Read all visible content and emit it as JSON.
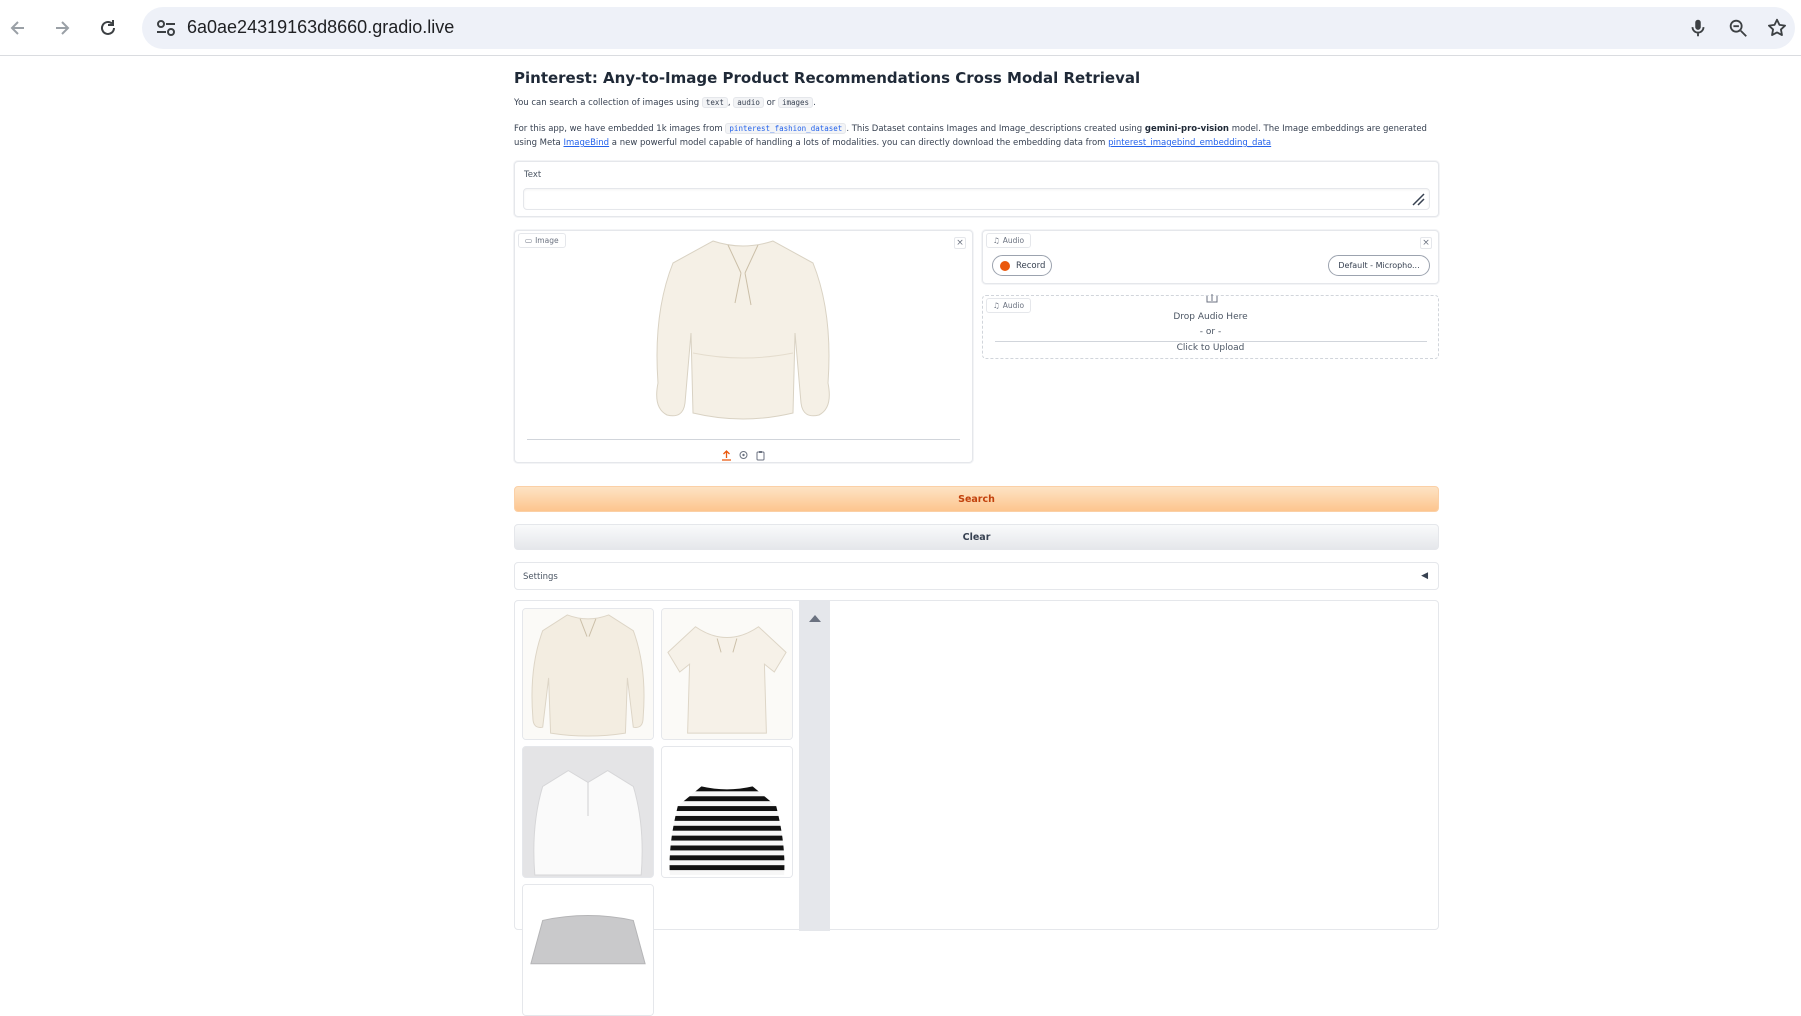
{
  "browser": {
    "url": "6a0ae24319163d8660.gradio.live"
  },
  "app": {
    "title": "Pinterest: Any-to-Image Product Recommendations Cross Modal Retrieval",
    "intro_prefix": "You can search a collection of images using",
    "intro_code_text": "text",
    "intro_sep": ",",
    "intro_code_audio": "audio",
    "intro_or": "or",
    "intro_code_images": "images",
    "intro_suffix": ".",
    "desc_part1": "For this app, we have embedded 1k images from",
    "desc_dataset": "pinterest_fashion_dataset",
    "desc_part2": ". This Dataset contains Images and Image_descriptions created using",
    "desc_model": "gemini-pro-vision",
    "desc_part3": "model. The Image embeddings are generated using Meta",
    "desc_link_imagebind": "ImageBind",
    "desc_part4": "a new powerful model capable of handling a lots of modalities. you can directly download the embedding data from",
    "desc_link_data": "pinterest_imagebind_embedding_data"
  },
  "text_input": {
    "label": "Text",
    "value": ""
  },
  "image_input": {
    "label": "Image"
  },
  "audio_record": {
    "label": "Audio",
    "record_label": "Record",
    "device": "Default - Micropho..."
  },
  "audio_upload": {
    "label": "Audio",
    "drop_text": "Drop Audio Here",
    "or_text": "- or -",
    "click_text": "Click to Upload"
  },
  "buttons": {
    "search": "Search",
    "clear": "Clear"
  },
  "settings": {
    "label": "Settings",
    "caret": "◀"
  },
  "gallery": {
    "items": [
      {
        "kind": "blouse-puff"
      },
      {
        "kind": "tee-tie"
      },
      {
        "kind": "shirt-white"
      },
      {
        "kind": "stripe-top"
      },
      {
        "kind": "grey-sweat"
      }
    ]
  },
  "colors": {
    "accent": "#ea580c",
    "search_gradient_start": "#fde3c4",
    "search_gradient_end": "#fdc58e",
    "link": "#2563eb"
  }
}
